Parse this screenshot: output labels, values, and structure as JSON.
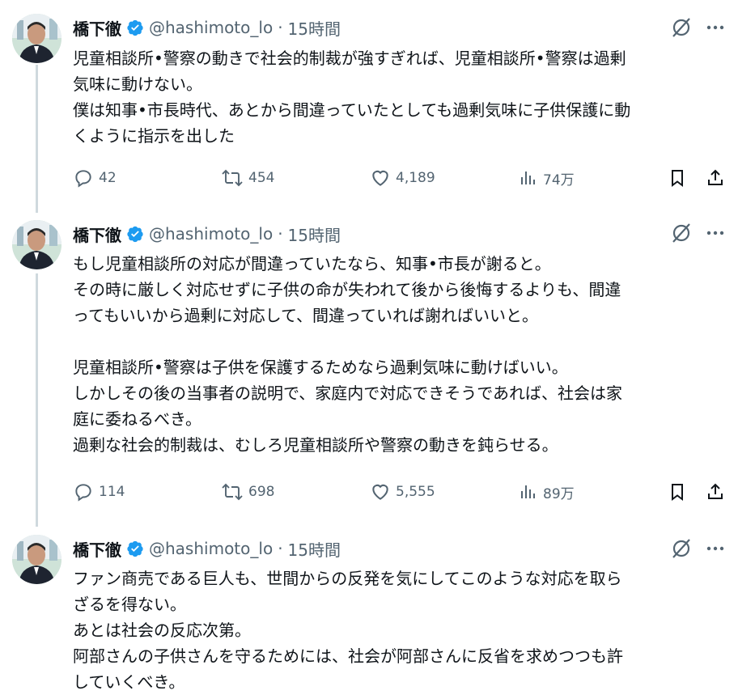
{
  "tweets": [
    {
      "name": "橋下徹",
      "handle": "@hashimoto_lo",
      "separator": "·",
      "time": "15時間",
      "lines": [
        "児童相談所•警察の動きで社会的制裁が強すぎれば、児童相談所•警察は過剰",
        "気味に動けない。",
        "僕は知事•市長時代、あとから間違っていたとしても過剰気味に子供保護に動",
        "くように指示を出した"
      ],
      "replies": "42",
      "reposts": "454",
      "likes": "4,189",
      "views": "74万"
    },
    {
      "name": "橋下徹",
      "handle": "@hashimoto_lo",
      "separator": "·",
      "time": "15時間",
      "lines": [
        "もし児童相談所の対応が間違っていたなら、知事•市長が謝ると。",
        "その時に厳しく対応せずに子供の命が失われて後から後悔するよりも、間違",
        "ってもいいから過剰に対応して、間違っていれば謝ればいいと。",
        "",
        "児童相談所•警察は子供を保護するためなら過剰気味に動けばいい。",
        "しかしその後の当事者の説明で、家庭内で対応できそうであれば、社会は家",
        "庭に委ねるべき。",
        "過剰な社会的制裁は、むしろ児童相談所や警察の動きを鈍らせる。"
      ],
      "replies": "114",
      "reposts": "698",
      "likes": "5,555",
      "views": "89万"
    },
    {
      "name": "橋下徹",
      "handle": "@hashimoto_lo",
      "separator": "·",
      "time": "15時間",
      "lines": [
        "ファン商売である巨人も、世間からの反発を気にしてこのような対応を取ら",
        "ざるを得ない。",
        "あとは社会の反応次第。",
        "阿部さんの子供さんを守るためには、社会が阿部さんに反省を求めつつも許",
        "していくべき。"
      ]
    }
  ],
  "icons": {
    "verified": "verified-badge-icon",
    "grok": "grok-icon",
    "more": "more-icon",
    "reply": "reply-icon",
    "repost": "repost-icon",
    "like": "like-icon",
    "views": "views-icon",
    "bookmark": "bookmark-icon",
    "share": "share-icon"
  },
  "colors": {
    "text": "#0f1419",
    "secondary": "#536471",
    "verified": "#1d9bf0",
    "thread_line": "#cfd9de"
  }
}
